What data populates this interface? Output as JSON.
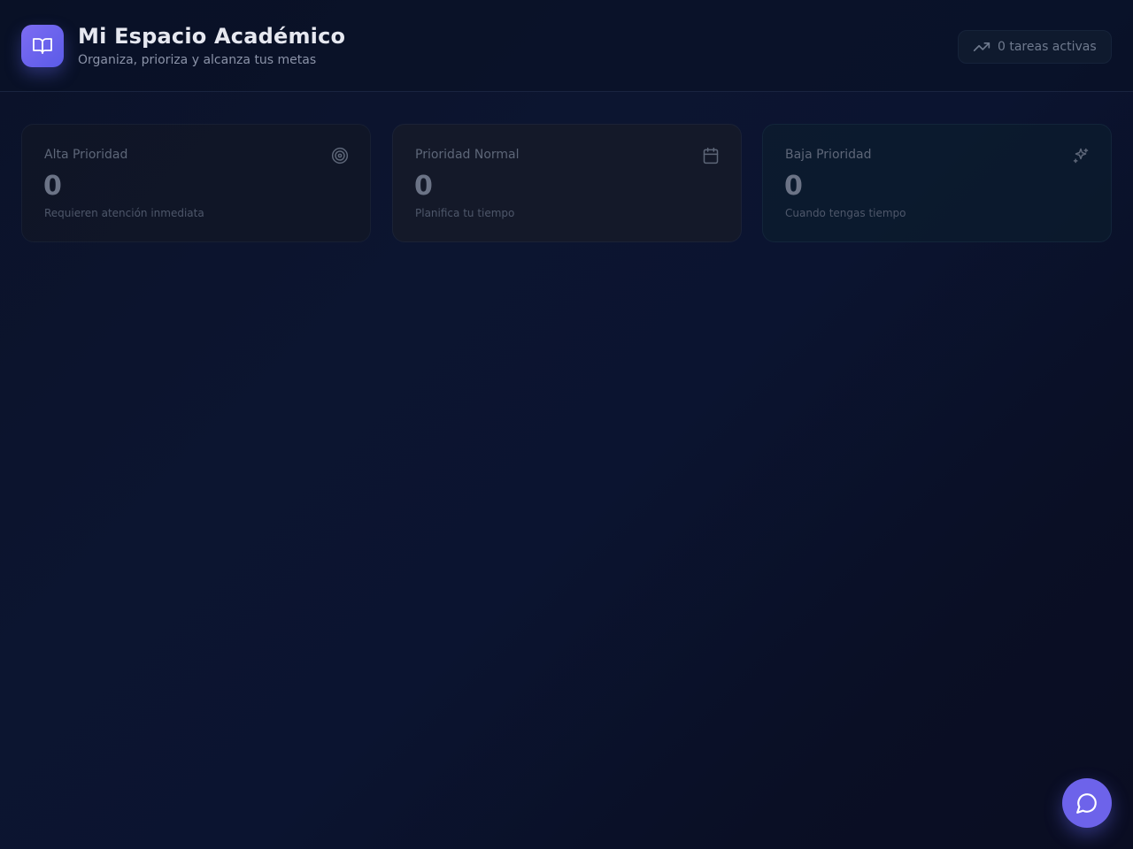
{
  "header": {
    "title": "Mi Espacio Académico",
    "subtitle": "Organiza, prioriza y alcanza tus metas",
    "brand_icon": "open-book-icon",
    "active_tasks": "0 tareas activas",
    "active_tasks_icon": "trending-up-icon"
  },
  "cards": [
    {
      "label": "Alta Prioridad",
      "count": "0",
      "description": "Requieren atención inmediata",
      "icon": "target-icon"
    },
    {
      "label": "Prioridad Normal",
      "count": "0",
      "description": "Planifica tu tiempo",
      "icon": "calendar-icon"
    },
    {
      "label": "Baja Prioridad",
      "count": "0",
      "description": "Cuando tengas tiempo",
      "icon": "sparkles-icon"
    }
  ],
  "chat": {
    "icon": "message-circle-icon"
  },
  "colors": {
    "accent": "#6d63ea",
    "background": "#0b1229",
    "text": "#e6e8f0"
  }
}
